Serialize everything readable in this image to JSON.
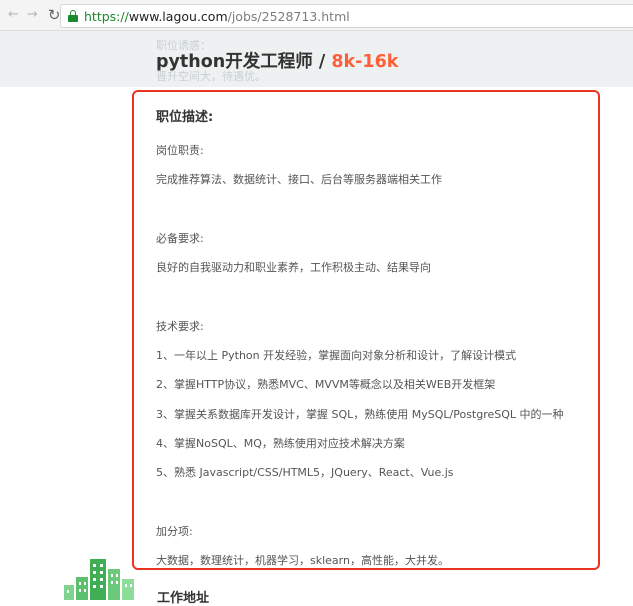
{
  "browser": {
    "back_icon": "arrow-left-icon",
    "forward_icon": "arrow-right-icon",
    "refresh_icon": "refresh-icon",
    "url_scheme": "https://",
    "url_host": "www.lagou.com",
    "url_path": "/jobs/2528713.html"
  },
  "header": {
    "ghost_top": "职位诱惑：",
    "ghost_bottom": "晋升空间大，待遇优。",
    "job_title": "python开发工程师",
    "separator": " / ",
    "salary": "8k-16k",
    "salary_color": "#fd5f39"
  },
  "description": {
    "heading": "职位描述:",
    "lines": [
      "岗位职责:",
      "完成推荐算法、数据统计、接口、后台等服务器端相关工作",
      "必备要求:",
      "良好的自我驱动力和职业素养，工作积极主动、结果导向",
      "技术要求:",
      "1、一年以上 Python 开发经验，掌握面向对象分析和设计，了解设计模式",
      "2、掌握HTTP协议，熟悉MVC、MVVM等概念以及相关WEB开发框架",
      "3、掌握关系数据库开发设计，掌握 SQL，熟练使用 MySQL/PostgreSQL 中的一种",
      "4、掌握NoSQL、MQ，熟练使用对应技术解决方案",
      "5、熟悉 Javascript/CSS/HTML5，JQuery、React、Vue.js",
      "加分项:",
      "大数据，数理统计，机器学习，sklearn，高性能，大并发。"
    ],
    "highlight_color": "#ea3323"
  },
  "footer": {
    "section_title": "工作地址",
    "illustration_icon": "city-buildings-icon"
  }
}
